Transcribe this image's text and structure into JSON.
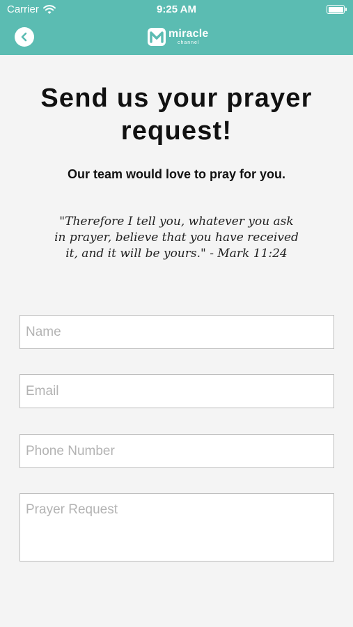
{
  "status_bar": {
    "carrier": "Carrier",
    "time": "9:25 AM"
  },
  "header": {
    "back_icon": "chevron-left-icon",
    "logo_title": "miracle",
    "logo_subtitle": "channel",
    "color": "#5bbcb2"
  },
  "content": {
    "title": "Send us your prayer request!",
    "subtitle": "Our team would love to pray for you.",
    "verse": "\"Therefore I tell you, whatever you ask in prayer, believe that you have received it, and it will be yours.\" - Mark 11:24"
  },
  "form": {
    "name_placeholder": "Name",
    "email_placeholder": "Email",
    "phone_placeholder": "Phone Number",
    "prayer_placeholder": "Prayer Request"
  }
}
